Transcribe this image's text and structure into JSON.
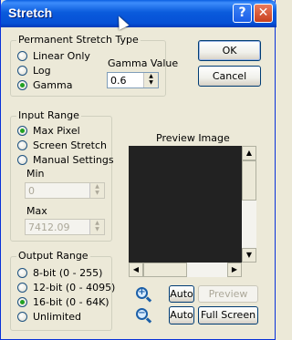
{
  "window": {
    "title": "Stretch",
    "help_glyph": "?",
    "close_glyph": "✕"
  },
  "stretch_type": {
    "legend": "Permanent Stretch Type",
    "options": [
      "Linear Only",
      "Log",
      "Gamma"
    ],
    "selected": "Gamma",
    "gamma_label": "Gamma Value",
    "gamma_value": "0.6"
  },
  "buttons": {
    "ok": "OK",
    "cancel": "Cancel"
  },
  "input_range": {
    "legend": "Input Range",
    "options": [
      "Max Pixel",
      "Screen Stretch",
      "Manual Settings"
    ],
    "selected": "Max Pixel",
    "min_label": "Min",
    "min_value": "0",
    "max_label": "Max",
    "max_value": "7412.09"
  },
  "output_range": {
    "legend": "Output Range",
    "options": [
      "8-bit (0 - 255)",
      "12-bit (0 - 4095)",
      "16-bit (0 - 64K)",
      "Unlimited"
    ],
    "selected": "16-bit (0 - 64K)"
  },
  "preview": {
    "label": "Preview Image",
    "auto_label_1": "Auto",
    "preview_button": "Preview",
    "auto_label_2": "Auto",
    "fullscreen_button": "Full Screen"
  },
  "icons": {
    "zoom_in": "zoom-in-icon",
    "zoom_out": "zoom-out-icon"
  }
}
